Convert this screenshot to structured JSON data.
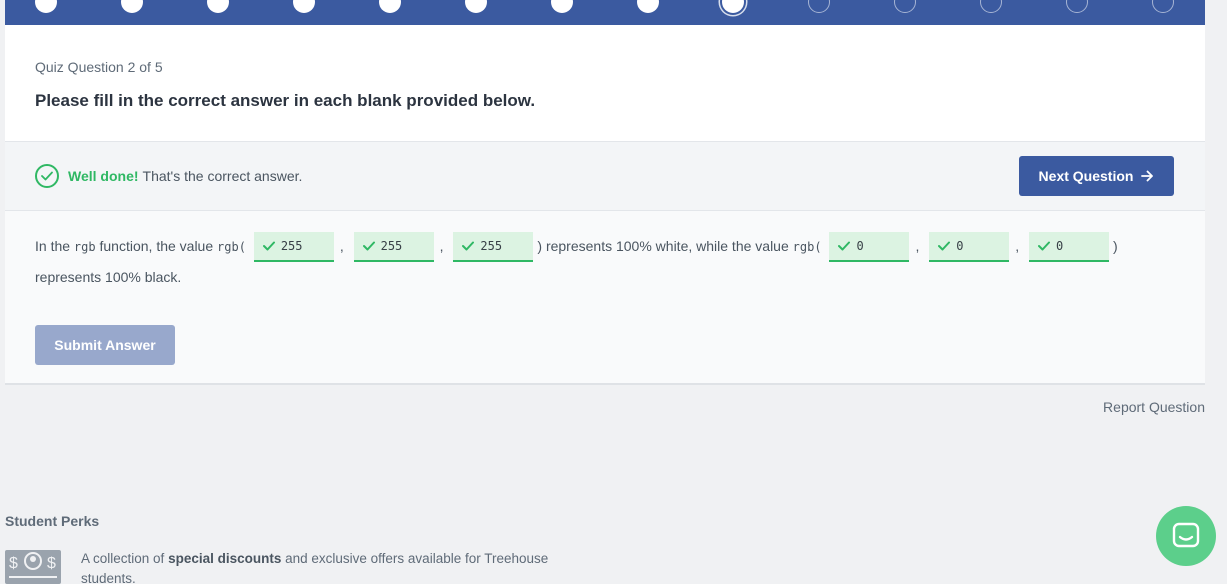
{
  "progress": {
    "completed_steps": 8,
    "current_step": 9,
    "total_steps": 14
  },
  "question": {
    "counter": "Quiz Question 2 of 5",
    "prompt": "Please fill in the correct answer in each blank provided below."
  },
  "feedback": {
    "label": "Well done!",
    "message": "That's the correct answer.",
    "icon": "check-circle-icon",
    "color": "#2fb864"
  },
  "next_button": {
    "label": "Next Question",
    "icon": "arrow-right-icon"
  },
  "sentence": {
    "part1": "In the ",
    "code_rgb_fn": "rgb",
    "part2": " function, the value ",
    "code_rgb_open_1": "rgb(",
    "blanks_white": [
      "255",
      "255",
      "255"
    ],
    "comma": ",",
    "part3": ") represents 100% white, while the value ",
    "code_rgb_open_2": "rgb(",
    "blanks_black": [
      "0",
      "0",
      "0"
    ],
    "close_paren": ")",
    "part4": "represents 100% black."
  },
  "submit_button": {
    "label": "Submit Answer"
  },
  "report_link": "Report Question",
  "perks": {
    "title": "Student Perks",
    "text_before": "A collection of ",
    "text_bold": "special discounts",
    "text_after": " and exclusive offers available for Treehouse students."
  },
  "colors": {
    "brand_blue": "#3b5aa0",
    "success_green": "#2fb864",
    "chat_green": "#5ccf8b"
  }
}
